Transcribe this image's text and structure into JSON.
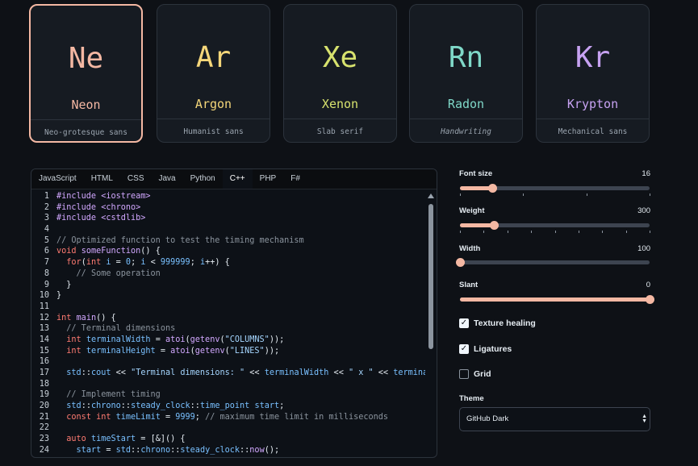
{
  "fonts": [
    {
      "symbol": "Ne",
      "name": "Neon",
      "description": "Neo-grotesque sans",
      "color": "#f4b8a3",
      "selected": true
    },
    {
      "symbol": "Ar",
      "name": "Argon",
      "description": "Humanist sans",
      "color": "#f5d77a",
      "selected": false
    },
    {
      "symbol": "Xe",
      "name": "Xenon",
      "description": "Slab serif",
      "color": "#d7e26e",
      "selected": false
    },
    {
      "symbol": "Rn",
      "name": "Radon",
      "description": "Handwriting",
      "color": "#7fd8c8",
      "selected": false
    },
    {
      "symbol": "Kr",
      "name": "Krypton",
      "description": "Mechanical sans",
      "color": "#c7a2f2",
      "selected": false
    }
  ],
  "editor": {
    "tabs": [
      "JavaScript",
      "HTML",
      "CSS",
      "Java",
      "Python",
      "C++",
      "PHP",
      "F#"
    ],
    "active_tab": "C++",
    "lines": [
      {
        "n": "1",
        "t": "#include <iostream>"
      },
      {
        "n": "2",
        "t": "#include <chrono>"
      },
      {
        "n": "3",
        "t": "#include <cstdlib>"
      },
      {
        "n": "4",
        "t": ""
      },
      {
        "n": "5",
        "t": "// Optimized function to test the timing mechanism"
      },
      {
        "n": "6",
        "t": "void someFunction() {"
      },
      {
        "n": "7",
        "t": "  for(int i = 0; i < 999999; i++) {"
      },
      {
        "n": "8",
        "t": "    // Some operation"
      },
      {
        "n": "9",
        "t": "  }"
      },
      {
        "n": "10",
        "t": "}"
      },
      {
        "n": "11",
        "t": ""
      },
      {
        "n": "12",
        "t": "int main() {"
      },
      {
        "n": "13",
        "t": "  // Terminal dimensions"
      },
      {
        "n": "14",
        "t": "  int terminalWidth = atoi(getenv(\"COLUMNS\"));"
      },
      {
        "n": "15",
        "t": "  int terminalHeight = atoi(getenv(\"LINES\"));"
      },
      {
        "n": "16",
        "t": ""
      },
      {
        "n": "17",
        "t": "  std::cout << \"Terminal dimensions: \" << terminalWidth << \" x \" << termina"
      },
      {
        "n": "18",
        "t": ""
      },
      {
        "n": "19",
        "t": "  // Implement timing"
      },
      {
        "n": "20",
        "t": "  std::chrono::steady_clock::time_point start;"
      },
      {
        "n": "21",
        "t": "  const int timeLimit = 9999; // maximum time limit in milliseconds"
      },
      {
        "n": "22",
        "t": ""
      },
      {
        "n": "23",
        "t": "  auto timeStart = [&]() {"
      },
      {
        "n": "24",
        "t": "    start = std::chrono::steady_clock::now();"
      }
    ]
  },
  "controls": {
    "font_size": {
      "label": "Font size",
      "value": "16",
      "fraction": 0.17
    },
    "weight": {
      "label": "Weight",
      "value": "300",
      "fraction": 0.18
    },
    "width": {
      "label": "Width",
      "value": "100",
      "fraction": 0.0
    },
    "slant": {
      "label": "Slant",
      "value": "0",
      "fraction": 1.0
    },
    "texture_healing": {
      "label": "Texture healing",
      "checked": true
    },
    "ligatures": {
      "label": "Ligatures",
      "checked": true
    },
    "grid": {
      "label": "Grid",
      "checked": false
    },
    "theme": {
      "label": "Theme",
      "value": "GitHub Dark"
    }
  },
  "colors": {
    "accent": "#f4b8a3",
    "background": "#0e1116",
    "panel": "#161b22"
  }
}
